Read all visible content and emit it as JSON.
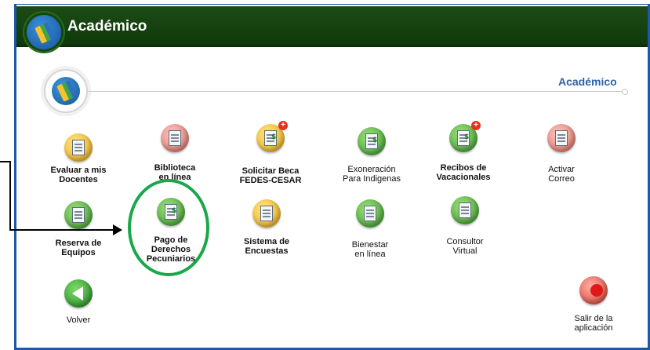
{
  "header": {
    "title": "Académico"
  },
  "section": {
    "title": "Académico"
  },
  "apps": [
    {
      "label": [
        "Evaluar a mis",
        "Docentes"
      ],
      "bold": true
    },
    {
      "label": [
        "Biblioteca",
        "en línea"
      ],
      "bold": true
    },
    {
      "label": [
        "Solicitar Beca",
        "FEDES-CESAR"
      ],
      "bold": true
    },
    {
      "label": [
        "Exoneración",
        "Para Indigenas"
      ],
      "bold": false
    },
    {
      "label": [
        "Recibos de",
        "Vacacionales"
      ],
      "bold": true
    },
    {
      "label": [
        "Activar",
        "Correo"
      ],
      "bold": false
    },
    {
      "label": [
        "Reserva de",
        "Equipos"
      ],
      "bold": true
    },
    {
      "label": [
        "Pago de",
        "Derechos",
        "Pecuniarios"
      ],
      "bold": true
    },
    {
      "label": [
        "Sistema de",
        "Encuestas"
      ],
      "bold": true
    },
    {
      "label": [
        "Bienestar",
        "en línea"
      ],
      "bold": false
    },
    {
      "label": [
        "Consultor",
        "Virtual"
      ],
      "bold": false
    },
    {
      "label": [
        "Volver"
      ],
      "bold": false
    },
    {
      "label": [
        "Salir de la",
        "aplicación"
      ],
      "bold": false
    }
  ],
  "colors": {
    "header_bg": "#1d4b14",
    "frame": "#1a5aa8",
    "section_title": "#2c63a8",
    "annotation": "#18a84a"
  },
  "icons": {
    "header": "academico-book-icon",
    "evaluate": "checklist-icon",
    "library": "book-icon",
    "scholarship": "form-dollar-icon",
    "exoneration": "document-dollar-icon",
    "receipts": "receipt-dollar-icon",
    "mail": "mail-icon",
    "equipment": "equipment-icon",
    "payment": "invoice-icon",
    "survey": "survey-icon",
    "wellbeing": "hands-icon",
    "advisor": "people-icon",
    "back": "back-arrow-icon",
    "exit": "exit-icon"
  }
}
